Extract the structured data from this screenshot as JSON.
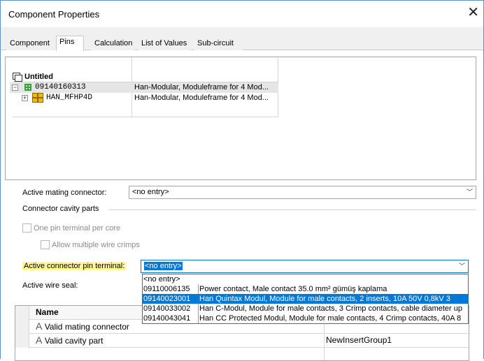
{
  "window": {
    "title": "Component Properties",
    "close_glyph": "✕"
  },
  "tabs": [
    {
      "label": "Component"
    },
    {
      "label": "Pins",
      "active": true
    },
    {
      "label": "Calculation"
    },
    {
      "label": "List of Values"
    },
    {
      "label": "Sub-circuit"
    }
  ],
  "tree": {
    "root_label": "Untitled",
    "items": [
      {
        "name": "09140160313",
        "description": "Han-Modular, Moduleframe for 4 Mod...",
        "icon": "component-green-icon"
      },
      {
        "name": "HAN_MFHP4D",
        "description": "Han-Modular, Moduleframe for 4 Mod...",
        "icon": "pin-group-icon"
      }
    ]
  },
  "form": {
    "active_mating_connector_label": "Active mating connector:",
    "active_mating_connector_value": "<no entry>",
    "connector_cavity_parts_label": "Connector cavity parts",
    "one_pin_terminal_label": "One pin terminal per core",
    "allow_multiple_crimps_label": "Allow multiple wire crimps",
    "active_pin_terminal_label": "Active connector pin terminal:",
    "active_pin_terminal_value": "<no entry>",
    "active_wire_seal_label": "Active wire seal:",
    "highlight_color": "#fff59a"
  },
  "dropdown": {
    "items": [
      {
        "code": "<no entry>",
        "desc": ""
      },
      {
        "code": "09110006135",
        "desc": "Power contact, Male contact 35.0 mm² gümüş kaplama"
      },
      {
        "code": "09140023001",
        "desc": "Han Quintax Modul, Module for male contacts, 2 inserts, 10A 50V 0,8kV 3",
        "selected": true
      },
      {
        "code": "09140033002",
        "desc": "Han C-Modul, Module for male contacts, 3 Crimp contacts, cable diameter up"
      },
      {
        "code": "09140043041",
        "desc": "Han CC Protected Modul, Module for male contacts, 4 Crimp contacts, 40A 8"
      }
    ]
  },
  "properties_grid": {
    "header": "Name",
    "rows": [
      {
        "name": "Valid mating connector",
        "value": ""
      },
      {
        "name": "Valid cavity part",
        "value": "NewInsertGroup1"
      }
    ]
  }
}
